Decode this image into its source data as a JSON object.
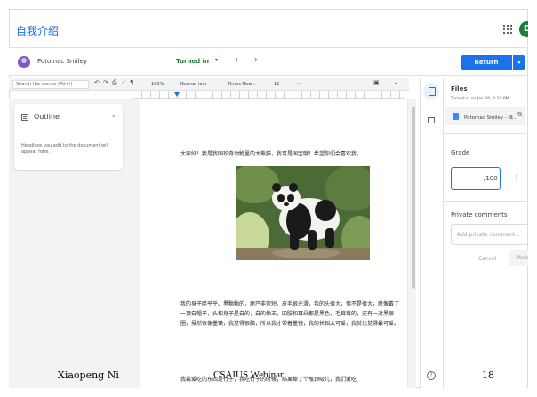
{
  "header": {
    "app_title": "自我介绍",
    "avatar_letter": "D",
    "apps_icon": "apps-grid-icon"
  },
  "student_bar": {
    "student_name": "Potomac Smiley",
    "status": "Turned in",
    "status_caret": "▾",
    "prev": "‹",
    "next": "›",
    "return_label": "Return",
    "return_caret": "▾"
  },
  "toolbar": {
    "search_placeholder": "Search the menus (Alt+/)",
    "zoom": "100%",
    "style": "Normal text",
    "font": "Times New...",
    "font_size": "12",
    "more": "···"
  },
  "outline": {
    "title": "Outline",
    "chevron": "‹",
    "note": "Headings you add to the document will appear here."
  },
  "doc": {
    "para1": "大家好！我是我国珍奇动物里的大熊猫，我可是国宝哦！希望你们会喜欢我。",
    "para2": "我的身子胖乎乎、黑黝黝的，尾巴非常短，皮毛很光滑，我的头很大，但不是很大，就像戴了一顶白帽子，头和身子是白的，白的像玉，四肢和耳朵都是黑色，毛茸茸的，还有一对黑眼圈，虽然很像墨镜，我觉得很酷，所以我才带着墨镜，我的长相太可爱，我就也觉得最可爱。",
    "para3": "我最爱吃的东西是竹子，我吃竹子的时候，结果掉了个瓶颈吸儿，我们爱吃"
  },
  "right_panel": {
    "files_title": "Files",
    "files_sub": "Turned in on Jan 26, 4:20 PM",
    "file_name": "Potomac Smiley - 自...",
    "grade_label": "Grade",
    "grade_denominator": "/100",
    "grade_value": "",
    "private_comments_label": "Private comments",
    "private_comments_placeholder": "Add private comment...",
    "cancel_label": "Cancel",
    "post_label": "Post"
  },
  "footer": {
    "left": "Xiaopeng Ni",
    "middle": "CSAIUS Webinar",
    "right": "18"
  },
  "colors": {
    "accent": "#1a73e8",
    "turned_in": "#188038",
    "avatar_bg": "#188038"
  }
}
